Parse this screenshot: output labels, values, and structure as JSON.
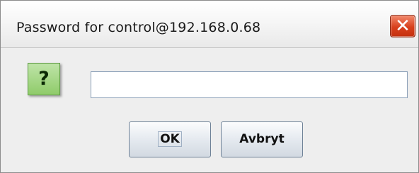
{
  "dialog": {
    "title": "Password for control@192.168.0.68",
    "close_label": "✕",
    "icon_glyph": "?",
    "password_value": "",
    "ok_label": "OK",
    "cancel_label": "Avbryt"
  },
  "colors": {
    "close_button": "#d8401c",
    "icon_green": "#8fcb6a",
    "dialog_background": "#eeeeee"
  },
  "icons": {
    "titlebar_close": "close-icon",
    "dialog_icon": "question-icon"
  }
}
